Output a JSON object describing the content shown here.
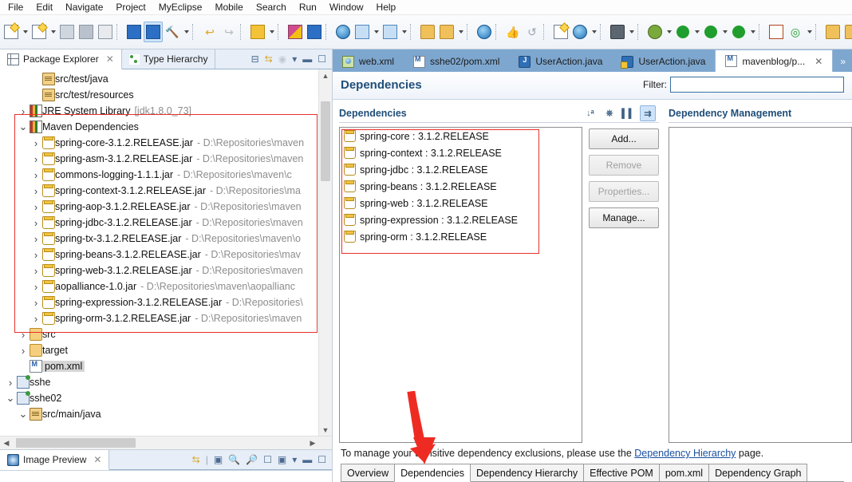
{
  "menubar": {
    "items": [
      "File",
      "Edit",
      "Navigate",
      "Project",
      "MyEclipse",
      "Mobile",
      "Search",
      "Run",
      "Window",
      "Help"
    ]
  },
  "toolbar": {
    "groups": [
      {
        "buttons": [
          {
            "name": "new-button",
            "icon": "new-doc-icon",
            "dropdown": true
          },
          {
            "name": "new-wizard-button",
            "icon": "new-wizard-icon",
            "dropdown": true
          },
          {
            "name": "save-button",
            "icon": "save-icon",
            "dropdown": false
          },
          {
            "name": "save-all-button",
            "icon": "save-all-icon",
            "dropdown": false
          },
          {
            "name": "print-button",
            "icon": "print-icon",
            "dropdown": false
          }
        ]
      },
      {
        "buttons": [
          {
            "name": "deploy-button",
            "icon": "deploy-icon",
            "dropdown": false
          },
          {
            "name": "run-server-button",
            "icon": "server-icon",
            "dropdown": false,
            "selected": true
          },
          {
            "name": "build-button",
            "icon": "hammer-icon",
            "dropdown": true
          }
        ]
      },
      {
        "buttons": [
          {
            "name": "undo-button",
            "icon": "undo-arrow-icon",
            "dropdown": false
          },
          {
            "name": "redo-button",
            "icon": "redo-arrow-icon",
            "dropdown": false
          }
        ]
      },
      {
        "buttons": [
          {
            "name": "java-perspective-button",
            "icon": "java-coffee-icon",
            "dropdown": true
          }
        ]
      },
      {
        "buttons": [
          {
            "name": "new-package-button",
            "icon": "package-purple-icon",
            "dropdown": false
          },
          {
            "name": "new-class-button",
            "icon": "package-blue-icon",
            "dropdown": false
          }
        ]
      },
      {
        "buttons": [
          {
            "name": "web20-button",
            "icon": "globe-20-icon",
            "dropdown": false
          },
          {
            "name": "new-wizard-blue-button",
            "icon": "wizard-blue-icon",
            "dropdown": true
          },
          {
            "name": "open-wizard-button",
            "icon": "wizard-open-icon",
            "dropdown": true
          }
        ]
      },
      {
        "buttons": [
          {
            "name": "import-button",
            "icon": "import-icon",
            "dropdown": false
          },
          {
            "name": "export-button",
            "icon": "export-icon",
            "dropdown": true
          }
        ]
      },
      {
        "buttons": [
          {
            "name": "web-browser-button",
            "icon": "globe-icon",
            "dropdown": false
          }
        ]
      },
      {
        "buttons": [
          {
            "name": "thumbs-up-button",
            "icon": "thumbs-up-icon",
            "dropdown": false
          },
          {
            "name": "refresh-button",
            "icon": "refresh-icon",
            "dropdown": false
          }
        ]
      },
      {
        "buttons": [
          {
            "name": "report-button",
            "icon": "report-icon",
            "dropdown": false
          },
          {
            "name": "browser-preview-button",
            "icon": "globe-search-icon",
            "dropdown": true
          }
        ]
      },
      {
        "buttons": [
          {
            "name": "snapshot-button",
            "icon": "camera-icon",
            "dropdown": true
          }
        ]
      },
      {
        "buttons": [
          {
            "name": "debug-button",
            "icon": "debug-bug-icon",
            "dropdown": true
          },
          {
            "name": "run-button",
            "icon": "run-green-icon",
            "dropdown": true
          },
          {
            "name": "run-history-button",
            "icon": "run-history-icon",
            "dropdown": true
          },
          {
            "name": "run-stop-button",
            "icon": "run-red-icon",
            "dropdown": true
          }
        ]
      },
      {
        "buttons": [
          {
            "name": "new-grid-button",
            "icon": "grid-icon",
            "dropdown": false
          },
          {
            "name": "git-button",
            "icon": "git-circle-icon",
            "dropdown": true
          }
        ]
      },
      {
        "buttons": [
          {
            "name": "open-folder-button",
            "icon": "open-folder-icon",
            "dropdown": false
          },
          {
            "name": "folder-plain-button",
            "icon": "folder-icon",
            "dropdown": false
          },
          {
            "name": "pen-button",
            "icon": "pen-icon",
            "dropdown": true
          }
        ]
      }
    ]
  },
  "explorer": {
    "tabs": [
      {
        "label": "Package Explorer",
        "icon": "package-explorer-icon",
        "active": true,
        "closable": true
      },
      {
        "label": "Type Hierarchy",
        "icon": "type-hierarchy-icon",
        "active": false,
        "closable": false
      }
    ],
    "toolbar_icons": [
      "collapse-all-icon",
      "link-with-editor-icon",
      "view-menu-filter-icon",
      "view-menu-icon",
      "minimize-icon",
      "maximize-icon"
    ],
    "tree": [
      {
        "indent": 2,
        "twisty": "",
        "icon": "source-folder-icon",
        "label": "src/test/java",
        "path": ""
      },
      {
        "indent": 2,
        "twisty": "",
        "icon": "source-folder-icon",
        "label": "src/test/resources",
        "path": ""
      },
      {
        "indent": 1,
        "twisty": ">",
        "icon": "library-icon",
        "label": "JRE System Library",
        "path": "[jdk1.8.0_73]"
      },
      {
        "indent": 1,
        "twisty": "v",
        "icon": "library-icon",
        "label": "Maven Dependencies",
        "path": ""
      },
      {
        "indent": 2,
        "twisty": ">",
        "icon": "jar-icon",
        "label": "spring-core-3.1.2.RELEASE.jar",
        "path": "- D:\\Repositories\\maven"
      },
      {
        "indent": 2,
        "twisty": ">",
        "icon": "jar-icon",
        "label": "spring-asm-3.1.2.RELEASE.jar",
        "path": "- D:\\Repositories\\maven"
      },
      {
        "indent": 2,
        "twisty": ">",
        "icon": "jar-icon",
        "label": "commons-logging-1.1.1.jar",
        "path": "- D:\\Repositories\\maven\\c"
      },
      {
        "indent": 2,
        "twisty": ">",
        "icon": "jar-icon",
        "label": "spring-context-3.1.2.RELEASE.jar",
        "path": "- D:\\Repositories\\ma"
      },
      {
        "indent": 2,
        "twisty": ">",
        "icon": "jar-icon",
        "label": "spring-aop-3.1.2.RELEASE.jar",
        "path": "- D:\\Repositories\\maven"
      },
      {
        "indent": 2,
        "twisty": ">",
        "icon": "jar-icon",
        "label": "spring-jdbc-3.1.2.RELEASE.jar",
        "path": "- D:\\Repositories\\maven"
      },
      {
        "indent": 2,
        "twisty": ">",
        "icon": "jar-icon",
        "label": "spring-tx-3.1.2.RELEASE.jar",
        "path": "- D:\\Repositories\\maven\\o"
      },
      {
        "indent": 2,
        "twisty": ">",
        "icon": "jar-icon",
        "label": "spring-beans-3.1.2.RELEASE.jar",
        "path": "- D:\\Repositories\\mav"
      },
      {
        "indent": 2,
        "twisty": ">",
        "icon": "jar-icon",
        "label": "spring-web-3.1.2.RELEASE.jar",
        "path": "- D:\\Repositories\\maven"
      },
      {
        "indent": 2,
        "twisty": ">",
        "icon": "jar-icon",
        "label": "aopalliance-1.0.jar",
        "path": "- D:\\Repositories\\maven\\aopallianc"
      },
      {
        "indent": 2,
        "twisty": ">",
        "icon": "jar-icon",
        "label": "spring-expression-3.1.2.RELEASE.jar",
        "path": "- D:\\Repositories\\"
      },
      {
        "indent": 2,
        "twisty": ">",
        "icon": "jar-icon",
        "label": "spring-orm-3.1.2.RELEASE.jar",
        "path": "- D:\\Repositories\\maven"
      },
      {
        "indent": 1,
        "twisty": ">",
        "icon": "folder-icon",
        "label": "src",
        "path": ""
      },
      {
        "indent": 1,
        "twisty": ">",
        "icon": "folder-icon",
        "label": "target",
        "path": ""
      },
      {
        "indent": 1,
        "twisty": "",
        "icon": "pom-icon",
        "label": "pom.xml",
        "path": "",
        "selected": true
      },
      {
        "indent": 0,
        "twisty": ">",
        "icon": "project-icon",
        "label": "sshe",
        "path": ""
      },
      {
        "indent": 0,
        "twisty": "v",
        "icon": "project-icon",
        "label": "sshe02",
        "path": ""
      },
      {
        "indent": 1,
        "twisty": "v",
        "icon": "source-folder-icon",
        "label": "src/main/java",
        "path": ""
      }
    ]
  },
  "image_preview": {
    "tab_label": "Image Preview",
    "tab_icon": "image-preview-icon",
    "toolbar_icons": [
      "link-icon",
      "fit-image-icon",
      "zoom-out-icon",
      "zoom-in-icon",
      "actual-size-icon",
      "fit-window-icon",
      "view-menu-icon",
      "minimize-icon",
      "maximize-icon"
    ]
  },
  "editor": {
    "tabs": [
      {
        "label": "web.xml",
        "icon": "web-xml-icon",
        "active": false,
        "closable": false
      },
      {
        "label": "sshe02/pom.xml",
        "icon": "maven-pom-icon",
        "active": false,
        "closable": false
      },
      {
        "label": "UserAction.java",
        "icon": "java-file-icon",
        "active": false,
        "closable": false
      },
      {
        "label": "UserAction.java",
        "icon": "java-warning-file-icon",
        "active": false,
        "closable": false
      },
      {
        "label": "mavenblog/p...",
        "icon": "maven-pom-icon",
        "active": true,
        "closable": true
      }
    ],
    "overflow_label": "»"
  },
  "form": {
    "title": "Dependencies",
    "filter_label": "Filter:",
    "filter_value": "",
    "filter_placeholder": "",
    "sections": {
      "dependencies": {
        "title": "Dependencies",
        "tool_icons": [
          "sort-az-icon",
          "hierarchy-icon",
          "columns-icon",
          "flatten-icon"
        ],
        "items": [
          {
            "label": "spring-core : 3.1.2.RELEASE",
            "icon": "jar-icon"
          },
          {
            "label": "spring-context : 3.1.2.RELEASE",
            "icon": "jar-icon"
          },
          {
            "label": "spring-jdbc : 3.1.2.RELEASE",
            "icon": "jar-icon"
          },
          {
            "label": "spring-beans : 3.1.2.RELEASE",
            "icon": "jar-icon"
          },
          {
            "label": "spring-web : 3.1.2.RELEASE",
            "icon": "jar-icon"
          },
          {
            "label": "spring-expression : 3.1.2.RELEASE",
            "icon": "jar-icon"
          },
          {
            "label": "spring-orm : 3.1.2.RELEASE",
            "icon": "jar-icon"
          }
        ],
        "buttons": [
          {
            "label": "Add...",
            "enabled": true
          },
          {
            "label": "Remove",
            "enabled": false
          },
          {
            "label": "Properties...",
            "enabled": false
          },
          {
            "label": "Manage...",
            "enabled": true
          }
        ]
      },
      "dependency_management": {
        "title": "Dependency Management",
        "items": []
      }
    },
    "note_prefix": "To manage your transitive dependency exclusions, please use the ",
    "note_link": "Dependency Hierarchy",
    "note_suffix": " page.",
    "bottom_tabs": [
      {
        "label": "Overview",
        "active": false
      },
      {
        "label": "Dependencies",
        "active": true
      },
      {
        "label": "Dependency Hierarchy",
        "active": false
      },
      {
        "label": "Effective POM",
        "active": false
      },
      {
        "label": "pom.xml",
        "active": false
      },
      {
        "label": "Dependency Graph",
        "active": false
      }
    ]
  },
  "annotations": {
    "arrow_color": "#ee2b22",
    "rect_color": "#e8312a"
  }
}
